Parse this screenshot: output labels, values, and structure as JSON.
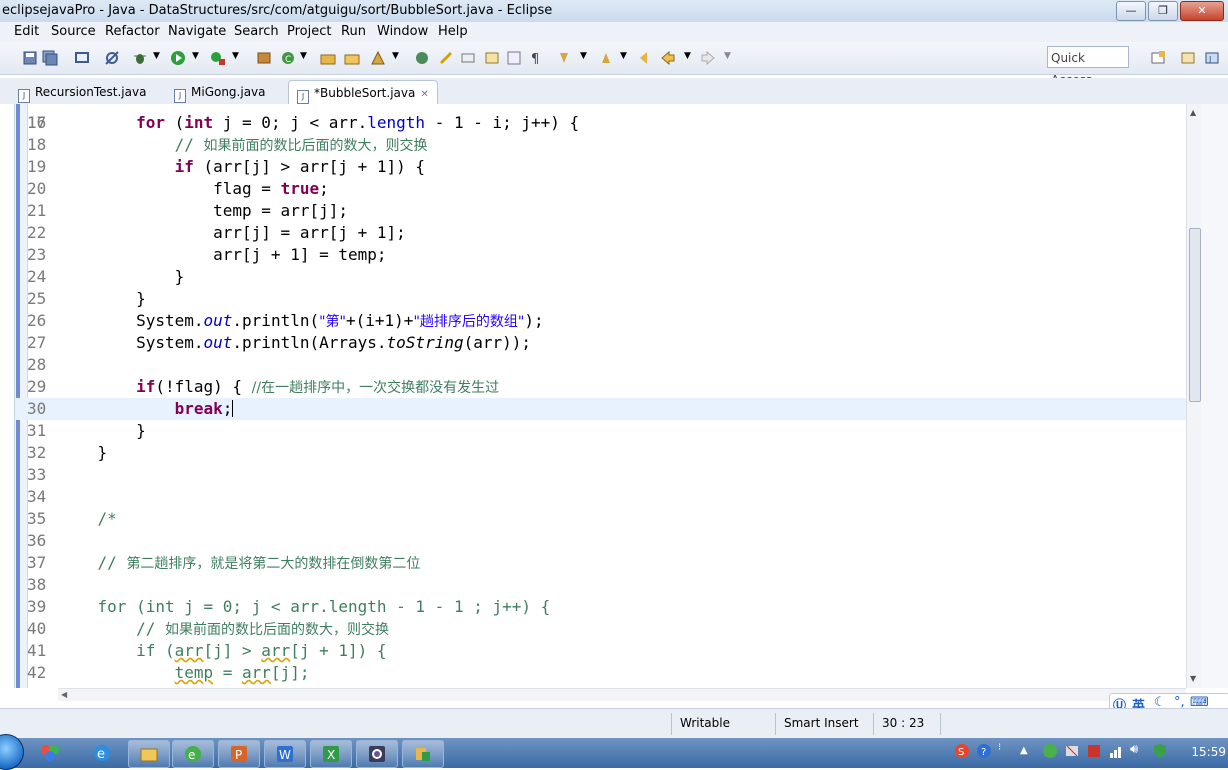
{
  "window": {
    "title": "eclipsejavaPro - Java - DataStructures/src/com/atguigu/sort/BubbleSort.java - Eclipse",
    "minimize": "—",
    "maximize": "❐",
    "close": "✕"
  },
  "menu": [
    "Edit",
    "Source",
    "Refactor",
    "Navigate",
    "Search",
    "Project",
    "Run",
    "Window",
    "Help"
  ],
  "toolbar": {
    "quick_access": "Quick Access"
  },
  "tabs": [
    {
      "label": "RecursionTest.java",
      "active": false
    },
    {
      "label": "MiGong.java",
      "active": false
    },
    {
      "label": "*BubbleSort.java",
      "active": true,
      "close": "✕"
    }
  ],
  "editor": {
    "partial_top_line": "16",
    "lines": [
      {
        "n": "17",
        "parts": [
          {
            "t": "        "
          },
          {
            "t": "for",
            "c": "kw"
          },
          {
            "t": " ("
          },
          {
            "t": "int",
            "c": "kw"
          },
          {
            "t": " j = 0; j < arr."
          },
          {
            "t": "length",
            "c": "fld"
          },
          {
            "t": " - 1 - i; j++) {"
          }
        ]
      },
      {
        "n": "18",
        "parts": [
          {
            "t": "            "
          },
          {
            "t": "// ",
            "c": "cmt"
          },
          {
            "t": "如果前面的数比后面的数大，则交换",
            "c": "cmt cmtz"
          }
        ]
      },
      {
        "n": "19",
        "parts": [
          {
            "t": "            "
          },
          {
            "t": "if",
            "c": "kw"
          },
          {
            "t": " (arr[j] > arr[j + 1]) {"
          }
        ]
      },
      {
        "n": "20",
        "parts": [
          {
            "t": "                flag = "
          },
          {
            "t": "true",
            "c": "kw"
          },
          {
            "t": ";"
          }
        ]
      },
      {
        "n": "21",
        "parts": [
          {
            "t": "                temp = arr[j];"
          }
        ]
      },
      {
        "n": "22",
        "parts": [
          {
            "t": "                arr[j] = arr[j + 1];"
          }
        ]
      },
      {
        "n": "23",
        "parts": [
          {
            "t": "                arr[j + 1] = temp;"
          }
        ]
      },
      {
        "n": "24",
        "parts": [
          {
            "t": "            }"
          }
        ]
      },
      {
        "n": "25",
        "parts": [
          {
            "t": "        }"
          }
        ]
      },
      {
        "n": "26",
        "parts": [
          {
            "t": "        System."
          },
          {
            "t": "out",
            "c": "sfld"
          },
          {
            "t": ".println("
          },
          {
            "t": "\"第\"",
            "c": "str"
          },
          {
            "t": "+(i+1)+"
          },
          {
            "t": "\"趟排序后的数组\"",
            "c": "str"
          },
          {
            "t": ");"
          }
        ]
      },
      {
        "n": "27",
        "parts": [
          {
            "t": "        System."
          },
          {
            "t": "out",
            "c": "sfld"
          },
          {
            "t": ".println(Arrays."
          },
          {
            "t": "toString",
            "c": "smeth"
          },
          {
            "t": "(arr));"
          }
        ]
      },
      {
        "n": "28",
        "parts": [
          {
            "t": ""
          }
        ]
      },
      {
        "n": "29",
        "parts": [
          {
            "t": "        "
          },
          {
            "t": "if",
            "c": "kw"
          },
          {
            "t": "(!flag) { "
          },
          {
            "t": "//在一趟排序中，一次交换都没有发生过",
            "c": "cmt cmtz"
          }
        ]
      },
      {
        "n": "30",
        "current": true,
        "parts": [
          {
            "t": "            "
          },
          {
            "t": "break",
            "c": "kw"
          },
          {
            "t": ";"
          }
        ]
      },
      {
        "n": "31",
        "parts": [
          {
            "t": "        }"
          }
        ]
      },
      {
        "n": "32",
        "parts": [
          {
            "t": "    }"
          }
        ]
      },
      {
        "n": "33",
        "parts": [
          {
            "t": ""
          }
        ]
      },
      {
        "n": "34",
        "parts": [
          {
            "t": ""
          }
        ]
      },
      {
        "n": "35",
        "parts": [
          {
            "t": "    "
          },
          {
            "t": "/*",
            "c": "cmt"
          }
        ]
      },
      {
        "n": "36",
        "parts": [
          {
            "t": ""
          }
        ]
      },
      {
        "n": "37",
        "parts": [
          {
            "t": "    "
          },
          {
            "t": "// ",
            "c": "cmt"
          },
          {
            "t": "第二趟排序，就是将第二大的数排在倒数第二位",
            "c": "cmt cmtz"
          }
        ]
      },
      {
        "n": "38",
        "parts": [
          {
            "t": ""
          }
        ]
      },
      {
        "n": "39",
        "parts": [
          {
            "t": "    for (int j = 0; j < arr.length - 1 - 1 ; j++) {",
            "c": "cmt"
          }
        ]
      },
      {
        "n": "40",
        "parts": [
          {
            "t": "        // ",
            "c": "cmt"
          },
          {
            "t": "如果前面的数比后面的数大，则交换",
            "c": "cmt cmtz"
          }
        ]
      },
      {
        "n": "41",
        "parts": [
          {
            "t": "        if (",
            "c": "cmt"
          },
          {
            "t": "arr",
            "c": "cmt warn"
          },
          {
            "t": "[j] > ",
            "c": "cmt"
          },
          {
            "t": "arr",
            "c": "cmt warn"
          },
          {
            "t": "[j + 1]) {",
            "c": "cmt"
          }
        ]
      },
      {
        "n": "42",
        "parts": [
          {
            "t": "            ",
            "c": "cmt"
          },
          {
            "t": "temp",
            "c": "cmt warn"
          },
          {
            "t": " = ",
            "c": "cmt"
          },
          {
            "t": "arr",
            "c": "cmt warn"
          },
          {
            "t": "[j];",
            "c": "cmt"
          }
        ]
      }
    ]
  },
  "status": {
    "writable": "Writable",
    "insert_mode": "Smart Insert",
    "position": "30 : 23"
  },
  "ime": {
    "label": "英"
  },
  "clock": "15:59",
  "colors": {
    "keyword": "#7f0055",
    "comment": "#3f7f5f",
    "string": "#2a00ff",
    "field": "#0000c0",
    "current_line": "#e8f2fe"
  }
}
